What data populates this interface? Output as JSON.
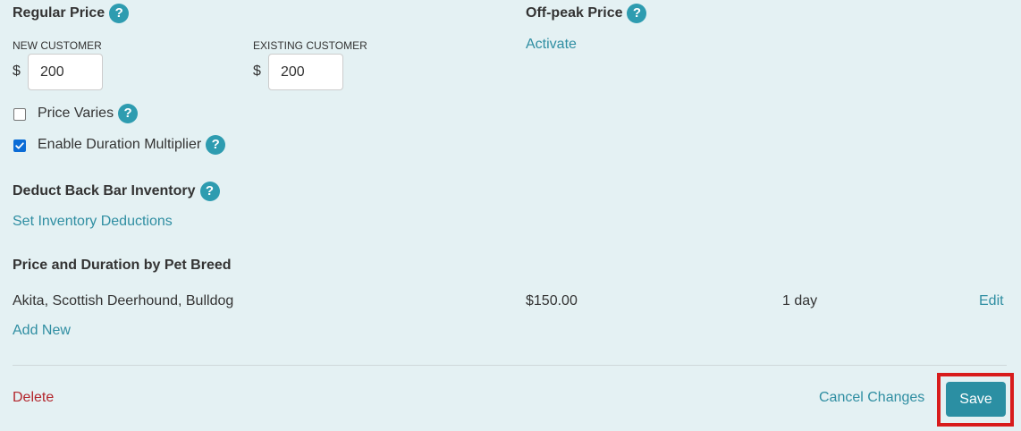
{
  "regular_price": {
    "heading": "Regular Price",
    "new_customer_label": "NEW CUSTOMER",
    "existing_customer_label": "EXISTING CUSTOMER",
    "currency_symbol": "$",
    "new_customer_value": "200",
    "existing_customer_value": "200"
  },
  "offpeak_price": {
    "heading": "Off-peak Price",
    "activate_link": "Activate"
  },
  "options": {
    "price_varies_label": "Price Varies",
    "price_varies_checked": false,
    "duration_multiplier_label": "Enable Duration Multiplier",
    "duration_multiplier_checked": true
  },
  "inventory": {
    "heading": "Deduct Back Bar Inventory",
    "set_deductions_link": "Set Inventory Deductions"
  },
  "breed_pricing": {
    "heading": "Price and Duration by Pet Breed",
    "rows": [
      {
        "breeds": "Akita, Scottish Deerhound, Bulldog",
        "price": "$150.00",
        "duration": "1 day",
        "edit_label": "Edit"
      }
    ],
    "add_new_label": "Add New"
  },
  "footer": {
    "delete_label": "Delete",
    "cancel_label": "Cancel Changes",
    "save_label": "Save"
  },
  "icons": {
    "help": "?"
  },
  "colors": {
    "background": "#e4f1f3",
    "link": "#2f8ea2",
    "help_icon": "#2e9cb0",
    "delete": "#b3262c",
    "save_button": "#2b8fa3",
    "highlight_border": "#d81c1c",
    "checkbox_checked": "#0b6cd6"
  }
}
